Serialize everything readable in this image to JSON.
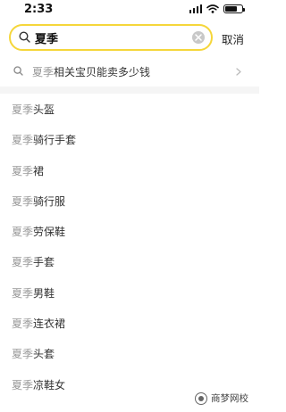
{
  "status_bar": {
    "time": "2:33"
  },
  "search": {
    "value": "夏季",
    "cancel_label": "取消"
  },
  "suggestion": {
    "keyword": "夏季",
    "text": "相关宝贝能卖多少钱"
  },
  "results": [
    {
      "keyword": "夏季",
      "suffix": "头盔"
    },
    {
      "keyword": "夏季",
      "suffix": "骑行手套"
    },
    {
      "keyword": "夏季",
      "suffix": "裙"
    },
    {
      "keyword": "夏季",
      "suffix": "骑行服"
    },
    {
      "keyword": "夏季",
      "suffix": "劳保鞋"
    },
    {
      "keyword": "夏季",
      "suffix": "手套"
    },
    {
      "keyword": "夏季",
      "suffix": "男鞋"
    },
    {
      "keyword": "夏季",
      "suffix": "连衣裙"
    },
    {
      "keyword": "夏季",
      "suffix": "头套"
    },
    {
      "keyword": "夏季",
      "suffix": "凉鞋女"
    }
  ],
  "watermark": {
    "text": "商梦网校"
  },
  "colors": {
    "search_border": "#f5d63a",
    "keyword": "#999999",
    "divider": "#f5f5f5"
  },
  "icons": [
    "signal-icon",
    "wifi-icon",
    "battery-icon",
    "search-icon",
    "clear-icon",
    "chevron-right-icon",
    "wechat-logo-icon"
  ]
}
